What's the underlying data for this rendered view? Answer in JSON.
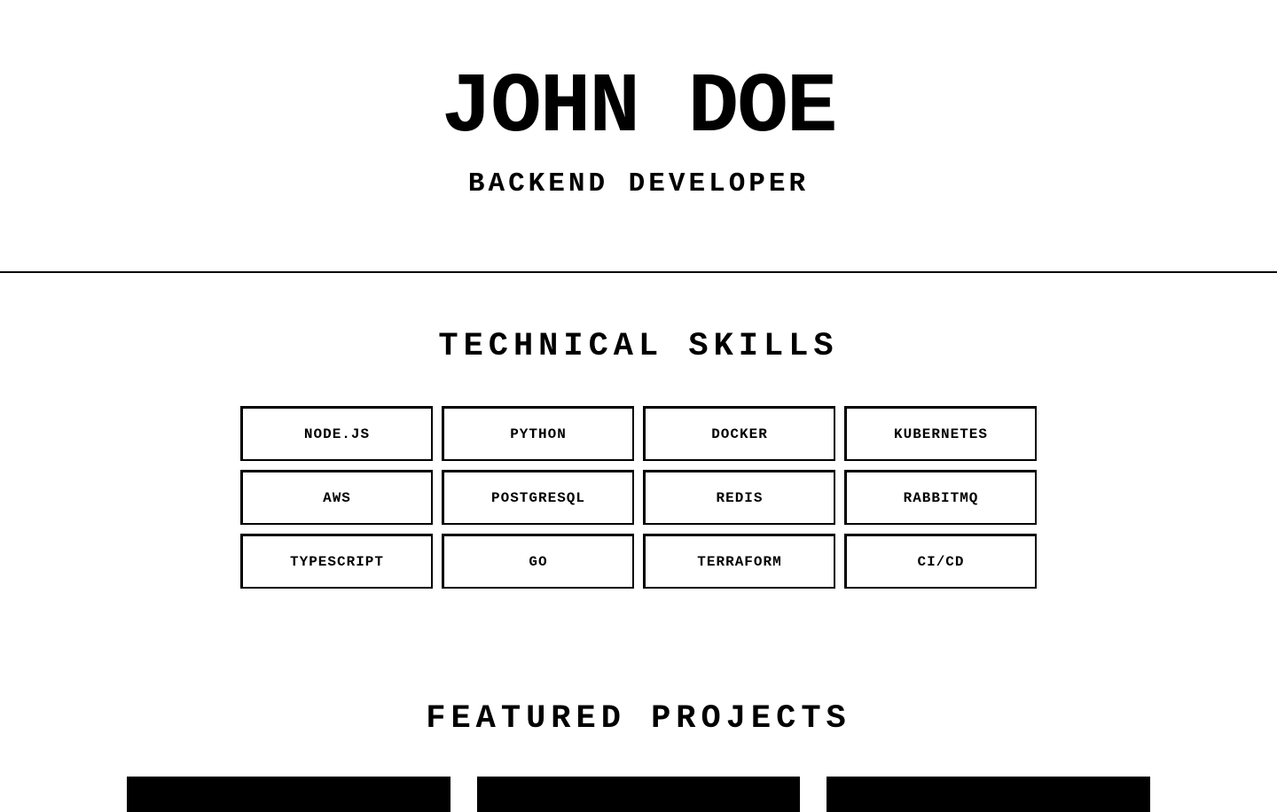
{
  "header": {
    "name": "JOHN DOE",
    "role": "BACKEND DEVELOPER"
  },
  "skills": {
    "title": "TECHNICAL SKILLS",
    "items": [
      "NODE.JS",
      "PYTHON",
      "DOCKER",
      "KUBERNETES",
      "AWS",
      "POSTGRESQL",
      "REDIS",
      "RABBITMQ",
      "TYPESCRIPT",
      "GO",
      "TERRAFORM",
      "CI/CD"
    ]
  },
  "projects": {
    "title": "FEATURED PROJECTS"
  }
}
